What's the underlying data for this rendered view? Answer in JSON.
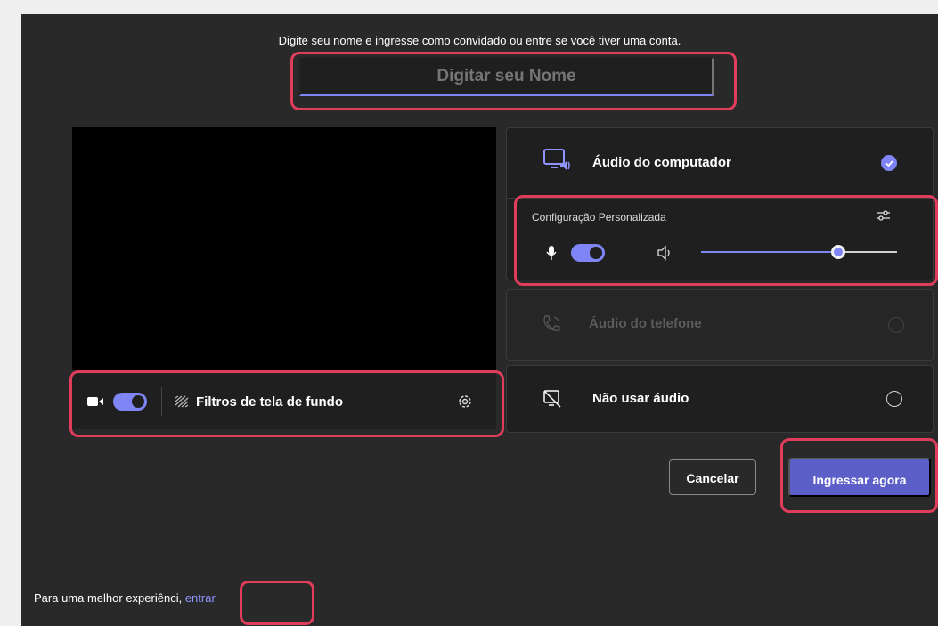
{
  "prompt": "Digite seu nome e ingresse como convidado ou entre se você tiver uma conta.",
  "name_input": {
    "placeholder": "Digitar seu Nome"
  },
  "video_bar": {
    "camera_on": true,
    "filters_label": "Filtros de tela de fundo"
  },
  "audio_options": {
    "computer": {
      "label": "Áudio do computador",
      "selected": true
    },
    "custom": {
      "label": "Configuração Personalizada",
      "mic_on": true,
      "volume_fraction": 0.7
    },
    "phone": {
      "label": "Áudio do telefone",
      "disabled": true
    },
    "none": {
      "label": "Não usar áudio",
      "selected": false
    }
  },
  "buttons": {
    "cancel": "Cancelar",
    "join": "Ingressar agora"
  },
  "footer": {
    "text": "Para uma melhor experiênci",
    "link": "entrar"
  },
  "colors": {
    "accent": "#7f85f5",
    "primary_button": "#5b5fc7",
    "highlight": "#e03c5c",
    "background": "#292929"
  }
}
